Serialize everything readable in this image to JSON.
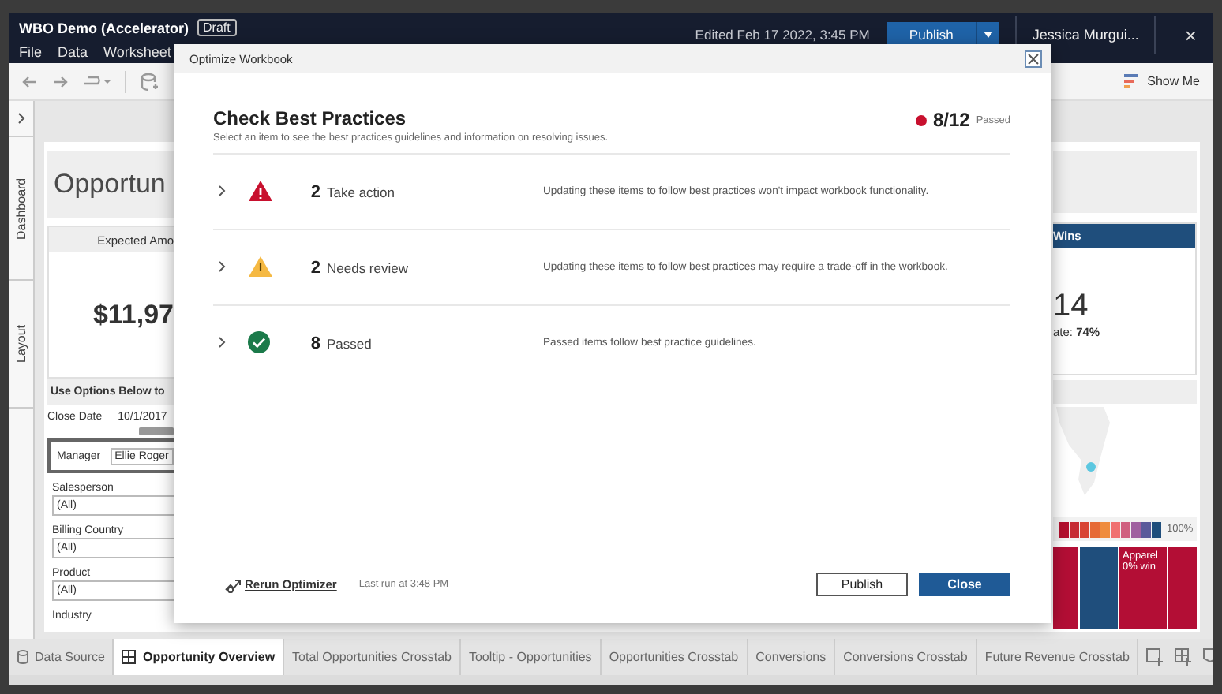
{
  "app_header": {
    "title": "WBO Demo (Accelerator)",
    "badge": "Draft",
    "edited": "Edited Feb 17 2022, 3:45 PM",
    "publish": "Publish",
    "user": "Jessica Murgui...",
    "close": "×"
  },
  "menu": [
    "File",
    "Data",
    "Worksheet"
  ],
  "toolbar": {
    "show_me": "Show Me"
  },
  "side_tabs": [
    {
      "label": "Dashboard"
    },
    {
      "label": "Layout"
    }
  ],
  "dashboard": {
    "title": "Opportun",
    "kpi_left": {
      "header": "Expected Amo",
      "value": "$11,97"
    },
    "filters_title": "Use Options Below to",
    "filters": [
      {
        "kind": "date",
        "label": "Close Date",
        "value": "10/1/2017",
        "level": 1
      },
      {
        "kind": "inline",
        "label": "Manager",
        "value": "Ellie Roger"
      },
      {
        "kind": "dropdown",
        "label": "Salesperson",
        "value": "(All)"
      },
      {
        "kind": "dropdown",
        "label": "Billing Country",
        "value": "(All)"
      },
      {
        "kind": "dropdown",
        "label": "Product",
        "value": "(All)"
      },
      {
        "kind": "label",
        "label": "Industry"
      }
    ],
    "kpi_right": {
      "header": "Wins",
      "value": "14",
      "sub": "ate: **74%**"
    },
    "legend": {
      "max_label": "100%"
    },
    "treemap": {
      "label": "Apparel",
      "sub": "0% win"
    }
  },
  "sheet_tabs": [
    {
      "kind": "source",
      "label": "Data Source",
      "selected": false
    },
    {
      "kind": "dashboard",
      "label": "Opportunity Overview",
      "selected": true
    },
    {
      "kind": "sheet",
      "label": "Total Opportunities Crosstab",
      "selected": false
    },
    {
      "kind": "sheet",
      "label": "Tooltip - Opportunities",
      "selected": false
    },
    {
      "kind": "sheet",
      "label": "Opportunities Crosstab",
      "selected": false
    },
    {
      "kind": "sheet",
      "label": "Conversions",
      "selected": false
    },
    {
      "kind": "sheet",
      "label": "Conversions Crosstab",
      "selected": false
    },
    {
      "kind": "sheet",
      "label": "Future Revenue Crosstab",
      "selected": false
    }
  ],
  "dialog": {
    "title": "Optimize Workbook",
    "heading": "Check Best Practices",
    "subtitle": "Select an item to see the best practices guidelines and information on resolving issues.",
    "score": "8/12",
    "score_label": "Passed",
    "rows": [
      {
        "kind": "error",
        "count": "2",
        "label": "Take action",
        "description": "Updating these items to follow best practices won't impact workbook functionality."
      },
      {
        "kind": "warning",
        "count": "2",
        "label": "Needs review",
        "description": "Updating these items to follow best practices may require a trade-off in the workbook."
      },
      {
        "kind": "passed",
        "count": "8",
        "label": "Passed",
        "description": "Passed items follow best practice guidelines."
      }
    ],
    "rerun": "Rerun Optimizer",
    "last_run": "Last run at 3:48 PM",
    "buttons": [
      {
        "kind": "secondary",
        "label": "Publish"
      },
      {
        "kind": "primary",
        "label": "Close"
      }
    ]
  }
}
